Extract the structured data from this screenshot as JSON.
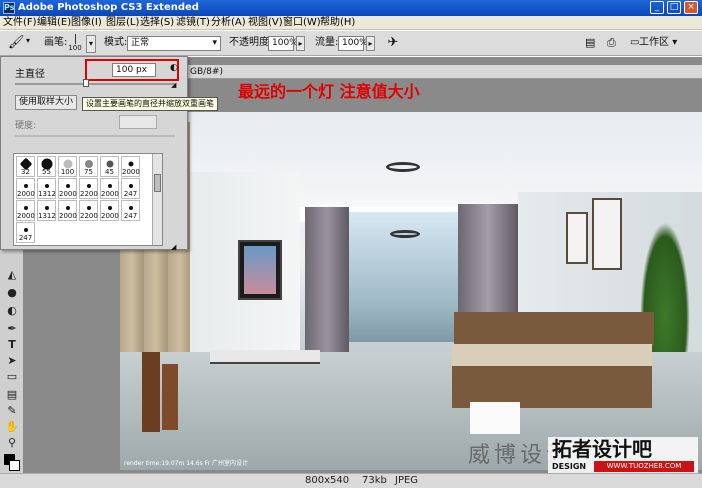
{
  "window": {
    "title": "Adobe Photoshop CS3 Extended",
    "logo": "Ps"
  },
  "menu": [
    "文件(F)",
    "编辑(E)",
    "图像(I)",
    "图层(L)",
    "选择(S)",
    "滤镜(T)",
    "分析(A)",
    "视图(V)",
    "窗口(W)",
    "帮助(H)"
  ],
  "options": {
    "brush_label": "画笔:",
    "brush_size": "100",
    "mode_label": "模式:",
    "mode_value": "正常",
    "opacity_label": "不透明度:",
    "opacity_value": "100%",
    "flow_label": "流量:",
    "flow_value": "100%",
    "workspace_label": "工作区"
  },
  "brush_panel": {
    "master_diameter_label": "主直径",
    "diameter_value": "100 px",
    "use_sample_size_button": "使用取样大小",
    "tooltip": "设置主要画笔的直径并缩放双重画笔",
    "hardness_label": "硬度:",
    "presets": [
      "32",
      "55",
      "100",
      "75",
      "45",
      "2000",
      "2000",
      "1312",
      "2000",
      "2200",
      "2000",
      "247",
      "2000",
      "1312",
      "2000",
      "2200",
      "2000",
      "247"
    ]
  },
  "document": {
    "tab_suffix": "GB/8#)"
  },
  "annotation": "最远的一个灯  注意值大小",
  "watermark": "威博设计",
  "logo": {
    "main": "拓者设计吧",
    "small": "DESIGN",
    "url": "WWW.TUOZHE8.COM"
  },
  "photo_caption": "render time:19.07m 14.6s Fr 广州室内设计",
  "status": {
    "dims": "800x540",
    "size": "73kb",
    "type": "JPEG"
  },
  "colors": {
    "accent_red": "#e10000",
    "title_bar": "#0a47b8",
    "logo_bg": "#c81414"
  }
}
